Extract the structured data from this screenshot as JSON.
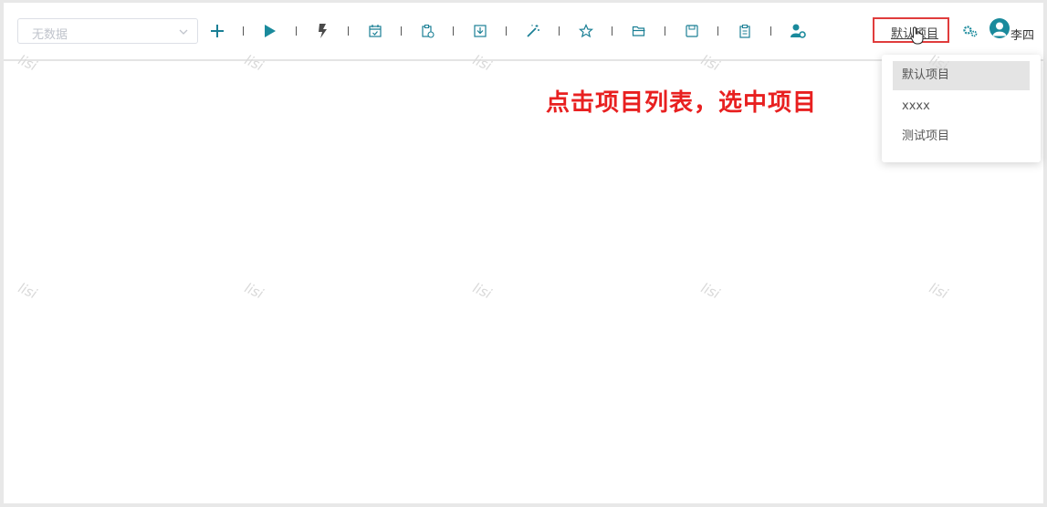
{
  "toolbar": {
    "select_placeholder": "无数据",
    "tools": [
      "add-icon",
      "play-icon",
      "bolt-icon",
      "calendar-check-icon",
      "clipboard-export-icon",
      "download-box-icon",
      "magic-wand-icon",
      "star-icon",
      "folder-open-icon",
      "save-icon",
      "clipboard-icon",
      "user-settings-icon"
    ]
  },
  "project": {
    "current_label": "默认项目"
  },
  "user": {
    "name": "李四"
  },
  "dropdown": {
    "items": [
      "默认项目",
      "xxxx",
      "测试项目"
    ],
    "selected": "默认项目"
  },
  "annotation": {
    "text": "点击项目列表，选中项目"
  },
  "watermark": {
    "text": "lisi"
  },
  "colors": {
    "accent": "#1a8a9c",
    "highlight": "#e03c3c",
    "annotation": "#e82020"
  }
}
